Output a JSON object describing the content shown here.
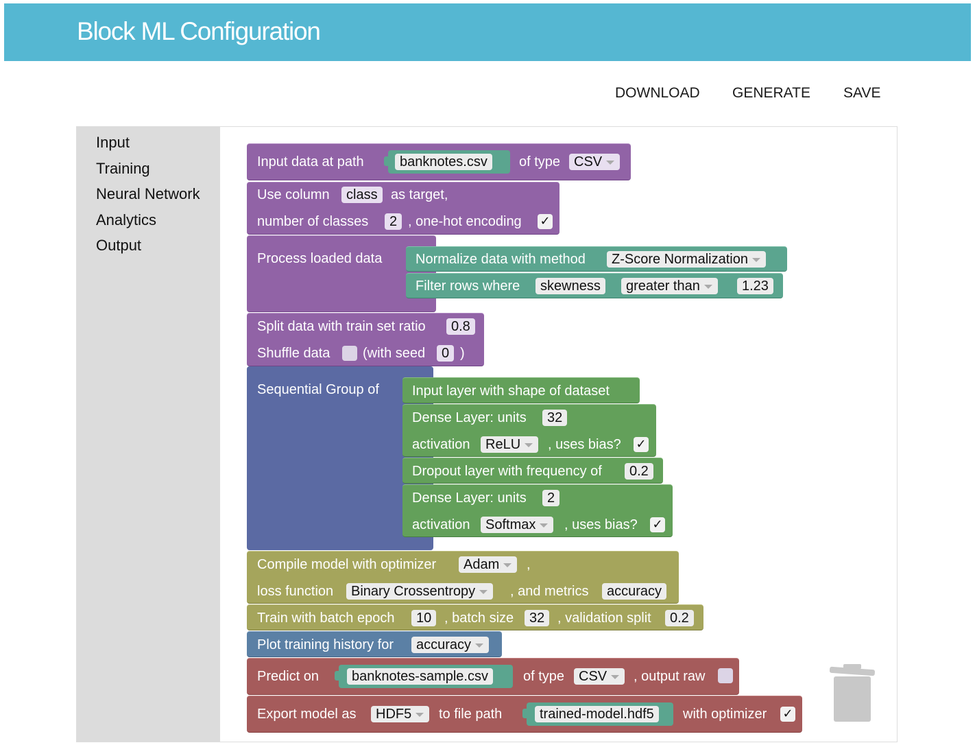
{
  "app": {
    "title": "Block ML Configuration"
  },
  "actions": {
    "download": "DOWNLOAD",
    "generate": "GENERATE",
    "save": "SAVE"
  },
  "toolbox": {
    "categories": [
      "Input",
      "Training",
      "Neural Network",
      "Analytics",
      "Output"
    ]
  },
  "colors": {
    "header": "#55b7d2",
    "data_blocks": "#9163a6",
    "value_blocks": "#5ba58f",
    "layer_blocks": "#63a05a",
    "group_block": "#5b6aa3",
    "training_blocks": "#a5a55c",
    "analytics_blocks": "#5b80a5",
    "output_blocks": "#a55b5b"
  },
  "blocks": {
    "input_data": {
      "label": "Input data at path",
      "path": "banknotes.csv",
      "type_label": "of type",
      "type_value": "CSV"
    },
    "target": {
      "label_use": "Use column",
      "column": "class",
      "label_as": "as target,",
      "label_classes": "number of classes",
      "classes": "2",
      "label_onehot": ", one-hot encoding",
      "onehot_checked": "✓"
    },
    "process": {
      "label": "Process loaded data"
    },
    "normalize": {
      "label": "Normalize data with method",
      "method": "Z-Score Normalization"
    },
    "filter": {
      "label": "Filter rows where",
      "column": "skewness",
      "operator": "greater than",
      "value": "1.23"
    },
    "split": {
      "label": "Split data with train set ratio",
      "ratio": "0.8",
      "shuffle_label": "Shuffle data",
      "seed_label": "(with seed",
      "seed": "0",
      "close": ")"
    },
    "sequential": {
      "label": "Sequential Group of"
    },
    "input_layer": {
      "label": "Input layer with shape of dataset"
    },
    "dense1": {
      "label": "Dense Layer: units",
      "units": "32",
      "activation_label": "activation",
      "activation": "ReLU",
      "bias_label": ", uses bias?",
      "bias": "✓"
    },
    "dropout": {
      "label": "Dropout layer with frequency of",
      "freq": "0.2"
    },
    "dense2": {
      "label": "Dense Layer: units",
      "units": "2",
      "activation_label": "activation",
      "activation": "Softmax",
      "bias_label": ", uses bias?",
      "bias": "✓"
    },
    "compile": {
      "label": "Compile model with optimizer",
      "optimizer": "Adam",
      "comma": ",",
      "loss_label": "loss function",
      "loss": "Binary Crossentropy",
      "metrics_label": ", and metrics",
      "metrics": "accuracy"
    },
    "train": {
      "label": "Train with batch epoch",
      "epoch": "10",
      "batch_label": ", batch size",
      "batch": "32",
      "val_label": ", validation split",
      "val": "0.2"
    },
    "plot": {
      "label": "Plot training history for",
      "metric": "accuracy"
    },
    "predict": {
      "label": "Predict on",
      "path": "banknotes-sample.csv",
      "type_label": "of type",
      "type_value": "CSV",
      "raw_label": ", output raw"
    },
    "export": {
      "label": "Export model as",
      "format": "HDF5",
      "path_label": "to file path",
      "path": "trained-model.hdf5",
      "optimizer_label": "with optimizer",
      "optimizer": "✓"
    }
  }
}
